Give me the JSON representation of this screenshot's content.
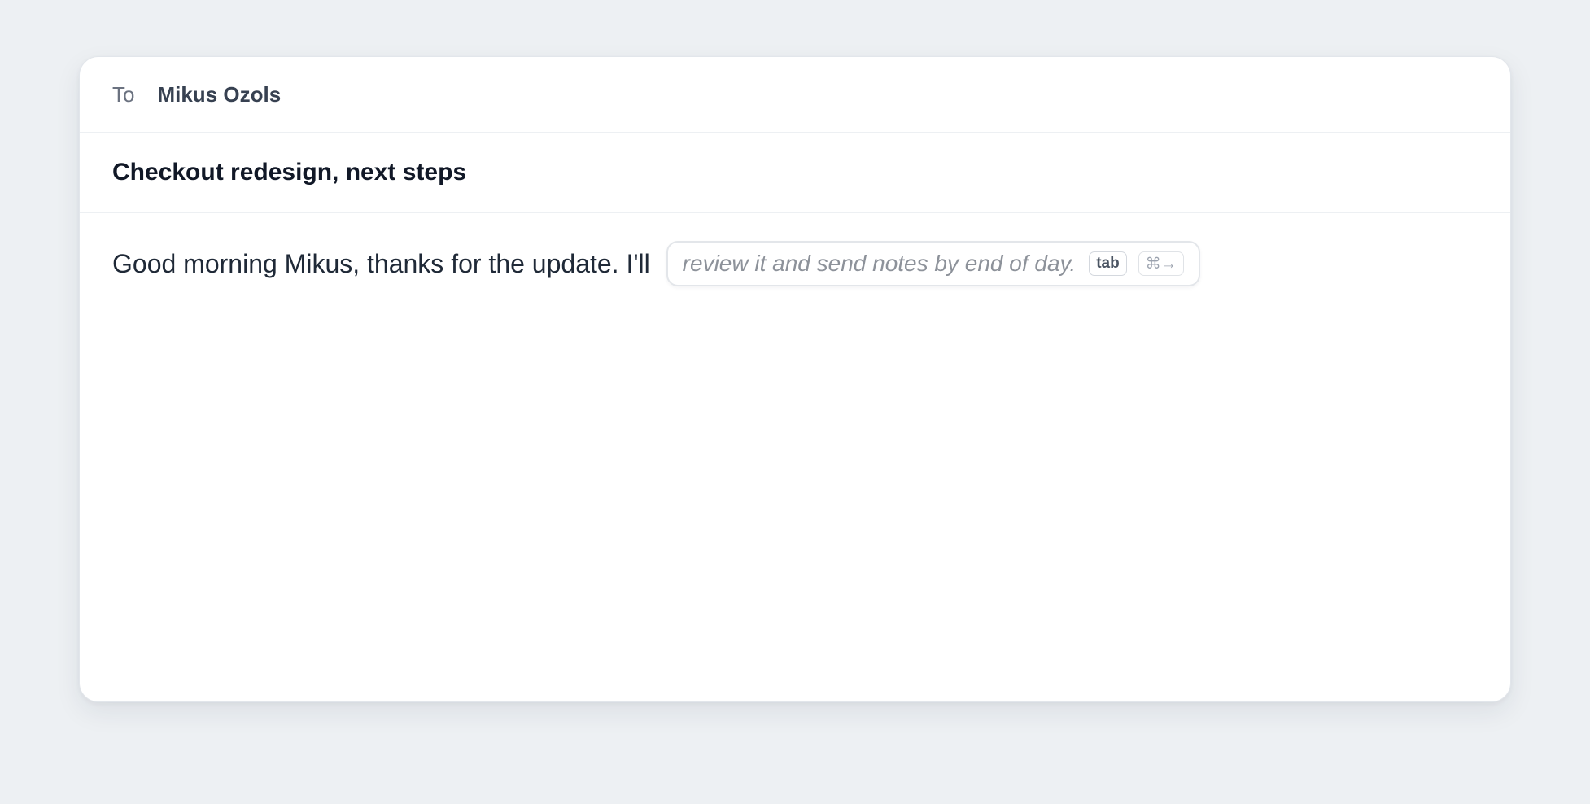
{
  "compose": {
    "to_label": "To",
    "recipient": "Mikus Ozols",
    "subject": "Checkout redesign, next steps",
    "body_text": "Good morning Mikus, thanks for the update. I'll",
    "suggestion": {
      "text": "review it and send notes by end of day.",
      "accept_key": "tab",
      "alt_key": "⌘→"
    }
  },
  "colors": {
    "background": "#edf0f3",
    "card": "#ffffff",
    "text_primary": "#111827",
    "text_muted": "#6b7280",
    "suggestion_text": "#8d929a"
  }
}
